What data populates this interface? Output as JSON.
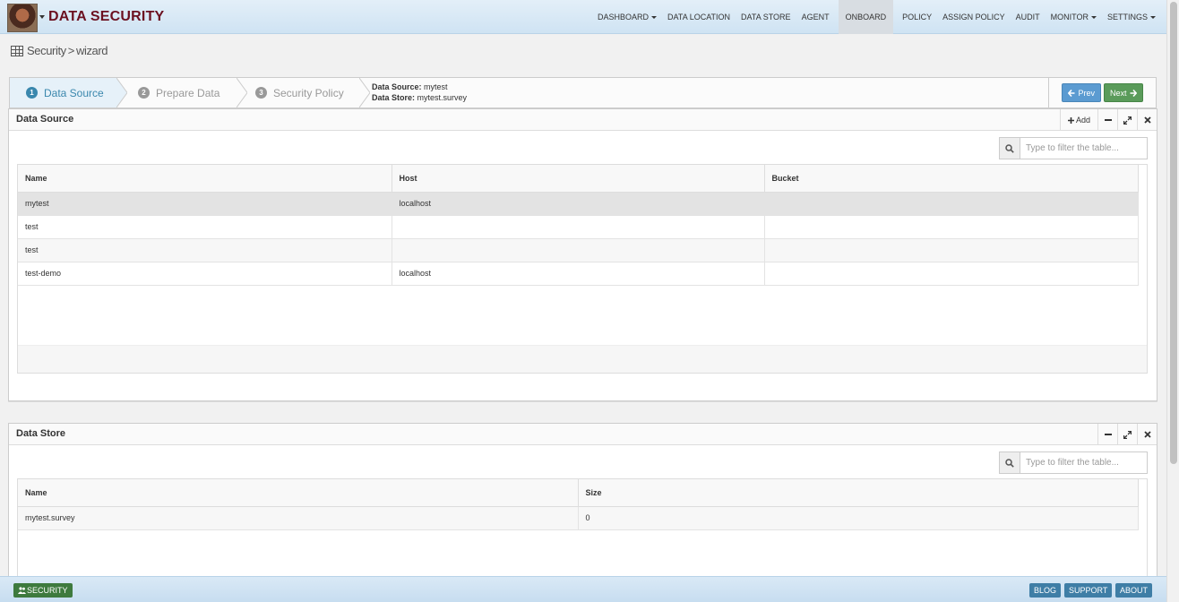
{
  "app": {
    "title": "DATA SECURITY"
  },
  "nav": [
    {
      "label": "DASHBOARD",
      "dropdown": true
    },
    {
      "label": "DATA LOCATION",
      "dropdown": false
    },
    {
      "label": "DATA STORE",
      "dropdown": false
    },
    {
      "label": "AGENT",
      "dropdown": false
    },
    {
      "label": "ONBOARD",
      "dropdown": false,
      "active": true
    },
    {
      "label": "POLICY",
      "dropdown": false
    },
    {
      "label": "ASSIGN POLICY",
      "dropdown": false
    },
    {
      "label": "AUDIT",
      "dropdown": false
    },
    {
      "label": "MONITOR",
      "dropdown": true
    },
    {
      "label": "SETTINGS",
      "dropdown": true
    }
  ],
  "breadcrumb": {
    "section": "Security",
    "separator": ">",
    "page": "wizard"
  },
  "wizard": {
    "steps": [
      {
        "num": "1",
        "label": "Data Source",
        "active": true
      },
      {
        "num": "2",
        "label": "Prepare Data"
      },
      {
        "num": "3",
        "label": "Security Policy"
      }
    ],
    "info": {
      "source_label": "Data Source:",
      "source_value": "mytest",
      "store_label": "Data Store:",
      "store_value": "mytest.survey"
    },
    "prev_label": "Prev",
    "next_label": "Next"
  },
  "data_source_panel": {
    "title": "Data Source",
    "add_label": "Add",
    "filter_placeholder": "Type to filter the table...",
    "columns": [
      "Name",
      "Host",
      "Bucket"
    ],
    "rows": [
      {
        "name": "mytest",
        "host": "localhost",
        "bucket": ""
      },
      {
        "name": "test",
        "host": "",
        "bucket": ""
      },
      {
        "name": "test",
        "host": "",
        "bucket": ""
      },
      {
        "name": "test-demo",
        "host": "localhost",
        "bucket": ""
      }
    ]
  },
  "data_store_panel": {
    "title": "Data Store",
    "filter_placeholder": "Type to filter the table...",
    "columns": [
      "Name",
      "Size"
    ],
    "rows": [
      {
        "name": "mytest.survey",
        "size": "0"
      }
    ]
  },
  "footer": {
    "security_label": "SECURITY",
    "links": [
      "BLOG",
      "SUPPORT",
      "ABOUT"
    ]
  },
  "colors": {
    "brand": "#6b1020",
    "active_step": "#3a87ad",
    "prev_button": "#5b9bd1",
    "next_button": "#5a9b5a",
    "footer_badge": "#3e7a3e"
  }
}
